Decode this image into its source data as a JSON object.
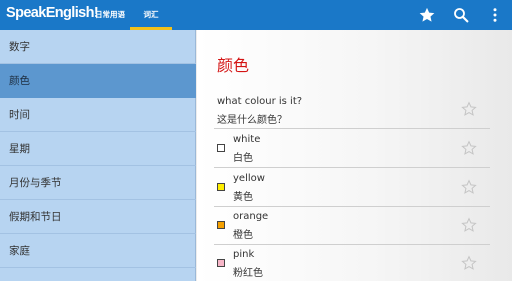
{
  "app": {
    "title": "SpeakEnglish!",
    "accent_color": "#1a78c8",
    "tab_indicator_color": "#f3c119"
  },
  "tabs": [
    {
      "label": "日常用语",
      "selected": false
    },
    {
      "label": "词汇",
      "selected": true
    }
  ],
  "actions": [
    {
      "icon": "star-icon"
    },
    {
      "icon": "search-icon"
    },
    {
      "icon": "more-vert-icon"
    }
  ],
  "sidebar": {
    "items": [
      {
        "label": "数字",
        "selected": false
      },
      {
        "label": "颜色",
        "selected": true
      },
      {
        "label": "时间",
        "selected": false
      },
      {
        "label": "星期",
        "selected": false
      },
      {
        "label": "月份与季节",
        "selected": false
      },
      {
        "label": "假期和节日",
        "selected": false
      },
      {
        "label": "家庭",
        "selected": false
      }
    ]
  },
  "content": {
    "heading": "颜色",
    "question": {
      "en": "what colour is it?",
      "zh": "这是什么颜色？"
    },
    "entries": [
      {
        "en": "white",
        "zh": "白色",
        "swatch": "#ffffff"
      },
      {
        "en": "yellow",
        "zh": "黄色",
        "swatch": "#ffee00"
      },
      {
        "en": "orange",
        "zh": "橙色",
        "swatch": "#f5a000"
      },
      {
        "en": "pink",
        "zh": "粉红色",
        "swatch": "#f7b6c8"
      }
    ]
  }
}
